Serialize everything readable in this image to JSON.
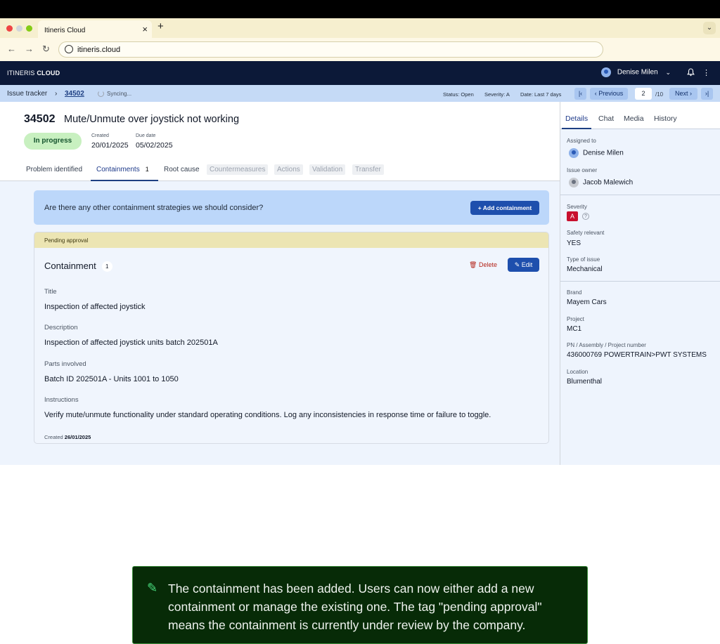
{
  "browser": {
    "tab_title": "Itineris Cloud",
    "tab_close": "×",
    "new_tab": "+",
    "url": "itineris.cloud"
  },
  "app": {
    "brand_prefix": "ITINERIS",
    "brand_suffix": "CLOUD",
    "user_name": "Denise Milen"
  },
  "subbar": {
    "crumb_root": "Issue tracker",
    "crumb_sep": "›",
    "crumb_id": "34502",
    "sync_text": "Syncing...",
    "status": "Status: Open",
    "severity": "Severity: A",
    "date_filter": "Date: Last 7 days",
    "prev_label": "‹ Previous",
    "next_label": "Next ›",
    "page_current": "2",
    "page_total": "/10"
  },
  "issue": {
    "id": "34502",
    "title": "Mute/Unmute over joystick not working",
    "status": "In progress",
    "created_label": "Created",
    "created_value": "20/01/2025",
    "due_label": "Due date",
    "due_value": "05/02/2025"
  },
  "tabs": {
    "problem": "Problem identified",
    "containments": "Containments",
    "containments_count": "1",
    "root_cause": "Root cause",
    "countermeasures": "Countermeasures",
    "actions": "Actions",
    "validation": "Validation",
    "transfer": "Transfer"
  },
  "prompt": {
    "question": "Are there any other containment strategies we should consider?",
    "add_label": "+ Add containment"
  },
  "containment": {
    "pending_label": "Pending approval",
    "heading": "Containment",
    "number": "1",
    "delete_label": "Delete",
    "edit_label": "Edit",
    "title_label": "Title",
    "title_value": "Inspection of affected joystick",
    "description_label": "Description",
    "description_value": "Inspection of affected joystick units batch 202501A",
    "parts_label": "Parts involved",
    "parts_value": "Batch ID 202501A - Units 1001 to 1050",
    "instructions_label": "Instructions",
    "instructions_value": "Verify mute/unmute functionality under standard operating conditions. Log any inconsistencies in response time or failure to toggle.",
    "created_label": "Created",
    "created_value": "26/01/2025"
  },
  "sidebar": {
    "tabs": [
      "Details",
      "Chat",
      "Media",
      "History"
    ],
    "assigned_label": "Assigned to",
    "assigned_value": "Denise Milen",
    "owner_label": "Issue owner",
    "owner_value": "Jacob Malewich",
    "severity_label": "Severity",
    "severity_value": "A",
    "safety_label": "Safety relevant",
    "safety_value": "YES",
    "type_label": "Type of issue",
    "type_value": "Mechanical",
    "brand_label": "Brand",
    "brand_value": "Mayem Cars",
    "project_label": "Project",
    "project_value": "MC1",
    "pn_label": "PN / Assembly / Project number",
    "pn_value": "436000769 POWERTRAIN>PWT SYSTEMS",
    "location_label": "Location",
    "location_value": "Blumenthal"
  },
  "toast": {
    "message": "The containment has been added. Users can now either add a new containment or manage the existing one. The tag \"pending approval\" means the containment is currently under review by the company."
  },
  "colors": {
    "app_bar": "#0c1938",
    "primary": "#1e4fad",
    "pending": "#ece5b3",
    "status_green": "#c8f0c0",
    "severity_red": "#c8102e"
  }
}
